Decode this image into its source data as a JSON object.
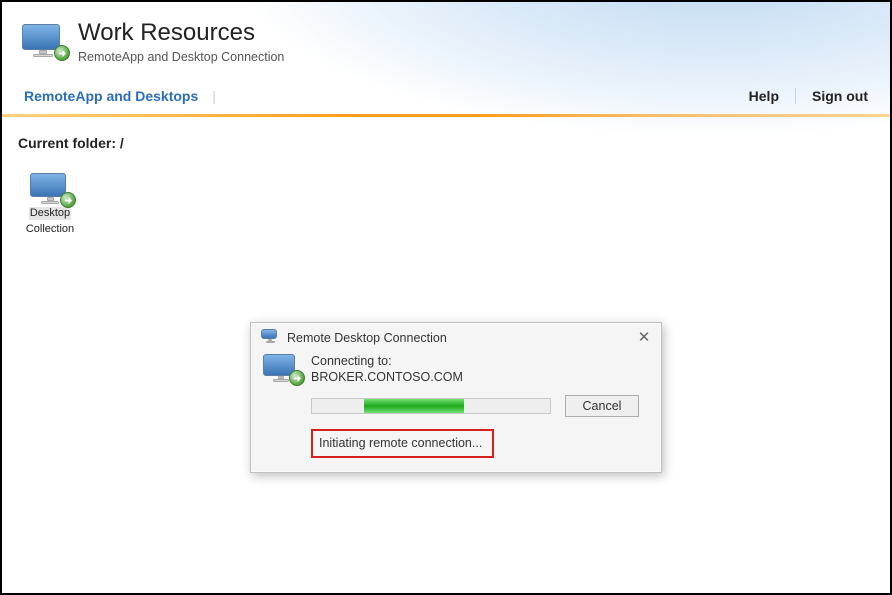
{
  "header": {
    "title": "Work Resources",
    "subtitle": "RemoteApp and Desktop Connection"
  },
  "nav": {
    "tab": "RemoteApp and Desktops",
    "help": "Help",
    "signout": "Sign out"
  },
  "main": {
    "breadcrumb": "Current folder: /",
    "items": [
      {
        "label_line1": "Desktop",
        "label_line2": "Collection"
      }
    ]
  },
  "dialog": {
    "title": "Remote Desktop Connection",
    "connecting_label": "Connecting to:",
    "target": "BROKER.CONTOSO.COM",
    "cancel": "Cancel",
    "status": "Initiating remote connection...",
    "progress": {
      "start_pct": 22,
      "end_pct": 64
    }
  }
}
